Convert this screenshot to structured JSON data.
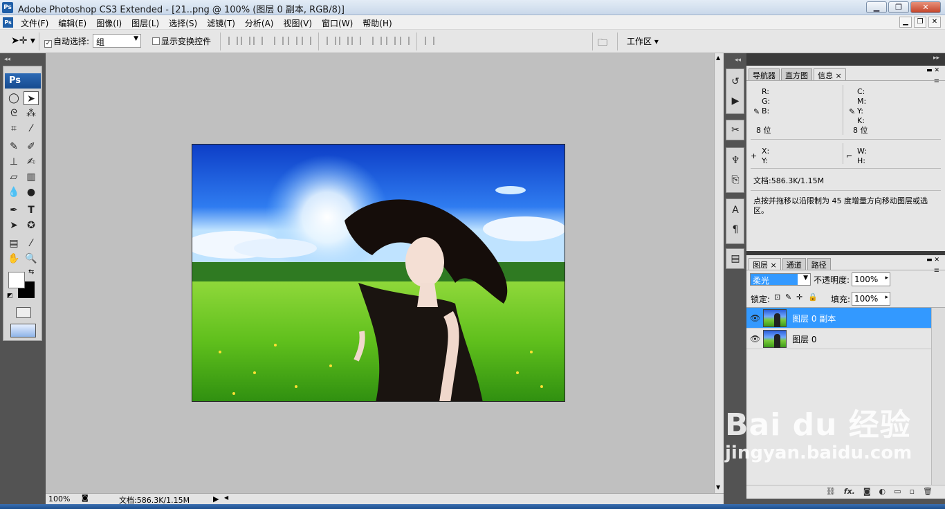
{
  "title_bar": {
    "app_icon": "Ps",
    "title": "Adobe Photoshop CS3 Extended - [21..png @ 100% (图层 0 副本, RGB/8)]",
    "minimize": "▁",
    "restore": "❐",
    "close": "✕"
  },
  "menu": {
    "app_icon": "Ps",
    "items": [
      "文件(F)",
      "编辑(E)",
      "图像(I)",
      "图层(L)",
      "选择(S)",
      "滤镜(T)",
      "分析(A)",
      "视图(V)",
      "窗口(W)",
      "帮助(H)"
    ],
    "doc_minimize": "▁",
    "doc_restore": "❐",
    "doc_close": "✕"
  },
  "options_bar": {
    "tool": "move-tool",
    "auto_select_label": "自动选择:",
    "auto_select_checked": true,
    "auto_select_value": "组",
    "show_transform_label": "显示变换控件",
    "show_transform_checked": false,
    "workspace_label": "工作区"
  },
  "toolbox": {
    "logo": "Ps"
  },
  "status_bar": {
    "zoom": "100%",
    "doc_info": "文档:586.3K/1.15M"
  },
  "info_panel": {
    "tabs": [
      "导航器",
      "直方图",
      "信息"
    ],
    "active_tab": "信息",
    "rgb_labels": [
      "R:",
      "G:",
      "B:"
    ],
    "cmyk_labels": [
      "C:",
      "M:",
      "Y:",
      "K:"
    ],
    "bits_left": "8 位",
    "bits_right": "8 位",
    "xy_labels": [
      "X:",
      "Y:"
    ],
    "wh_labels": [
      "W:",
      "H:"
    ],
    "doc_info": "文档:586.3K/1.15M",
    "hint": "点按并拖移以沿限制为 45 度增量方向移动图层或选区。"
  },
  "layers_panel": {
    "tabs": [
      "图层",
      "通道",
      "路径"
    ],
    "active_tab": "图层",
    "blend_mode": "柔光",
    "opacity_label": "不透明度:",
    "opacity": "100%",
    "lock_label": "锁定:",
    "fill_label": "填充:",
    "fill": "100%",
    "layers": [
      {
        "name": "图层 0 副本",
        "selected": true,
        "visible": true
      },
      {
        "name": "图层 0",
        "selected": false,
        "visible": true
      }
    ],
    "footer_fx": "fx."
  },
  "watermark": {
    "brand": "Bai du 经验",
    "url": "jingyan.baidu.com"
  },
  "colors": {
    "selection_blue": "#3399ff",
    "panel_bg": "#e6e6e6",
    "workspace_gray": "#c0c0c0",
    "dark_bg": "#535353"
  }
}
